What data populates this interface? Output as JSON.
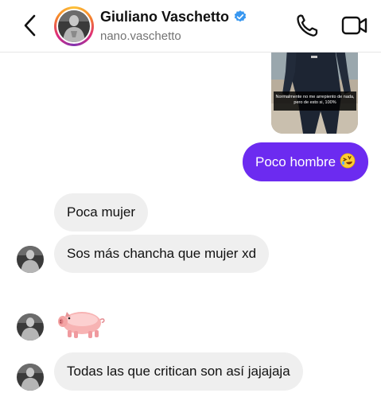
{
  "header": {
    "name": "Giuliano Vaschetto",
    "username": "nano.vaschetto"
  },
  "photo": {
    "caption": "Normalmente no me arrepiento de nada, pero de esto si, 100%"
  },
  "messages": {
    "m1": "Poco hombre",
    "m2": "Poca mujer",
    "m3": "Sos más chancha que mujer xd",
    "m5": "Todas las que critican son así jajajaja"
  },
  "emojis": {
    "m1": "rolling-on-floor-laughing-emoji",
    "m4": "pig-emoji"
  },
  "colors": {
    "outgoing_bubble": "#6c2bf0",
    "incoming_bubble": "#efefef",
    "verified_badge": "#3897f0"
  }
}
